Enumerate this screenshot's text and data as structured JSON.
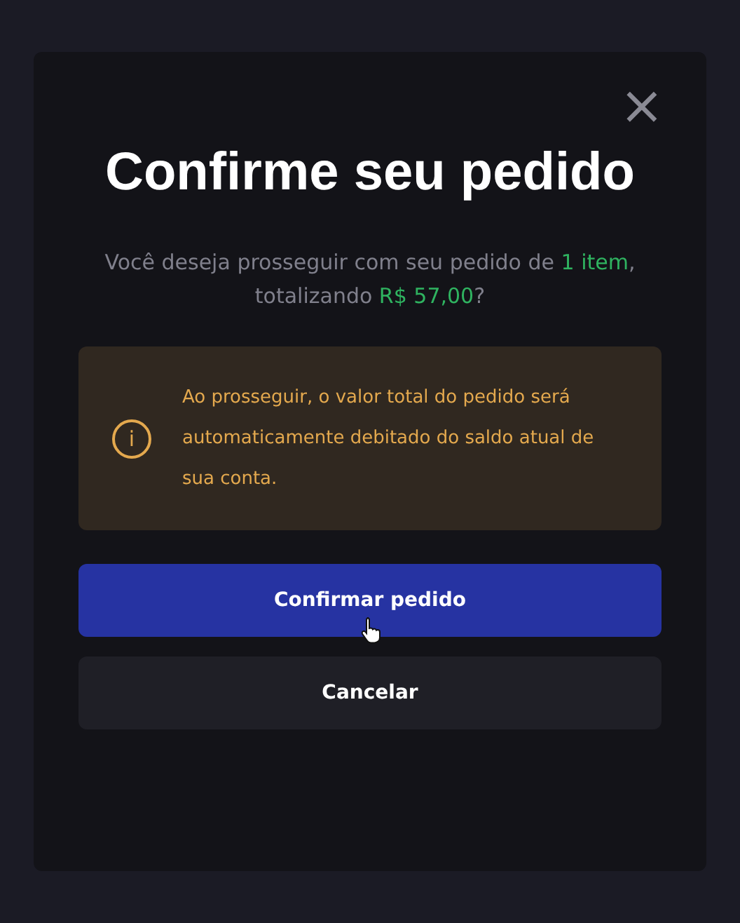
{
  "dialog": {
    "close_icon": "×",
    "title": "Confirme seu pedido",
    "message": "Você deseja prosseguir com seu pedido de **1 item**, totalizando **R$ 57,00**?",
    "notice": {
      "icon": "i",
      "text": "Ao prosseguir, o valor total do pedido será automaticamente debitado do saldo atual de sua conta."
    },
    "buttons": [
      {
        "label": "Confirmar pedido",
        "kind": "primary",
        "hovered": true
      },
      {
        "label": "Cancelar",
        "kind": "secondary",
        "hovered": false
      }
    ]
  }
}
